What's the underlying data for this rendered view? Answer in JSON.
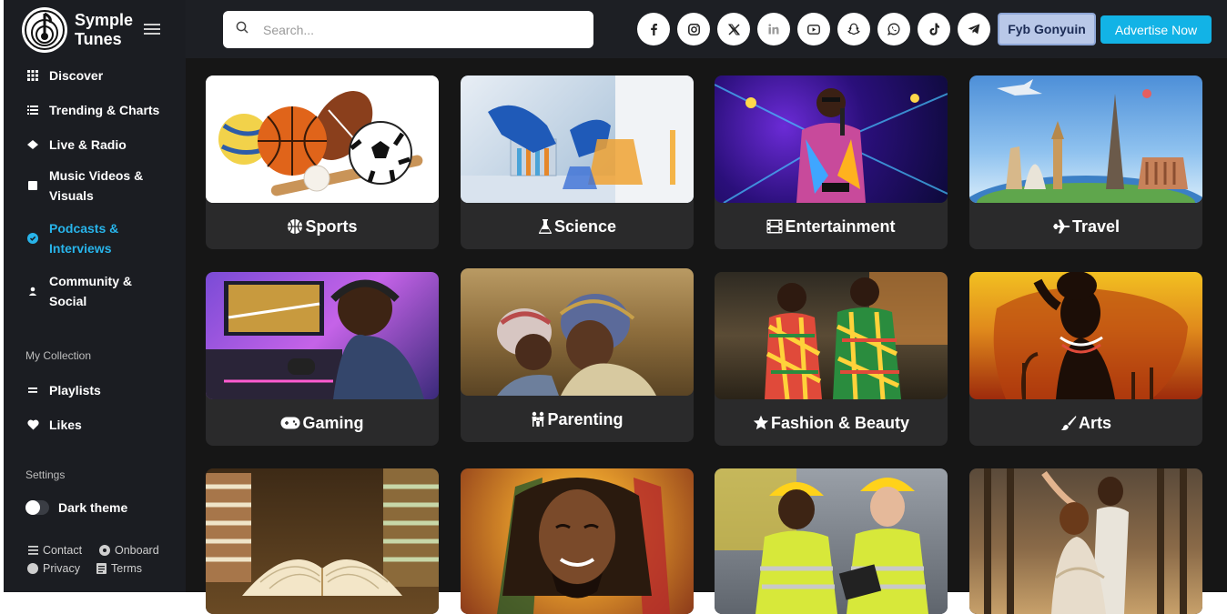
{
  "brand": {
    "name_line1": "Symple",
    "name_line2": "Tunes"
  },
  "nav": [
    {
      "label": "Discover",
      "icon": "grid-icon"
    },
    {
      "label": "Trending & Charts",
      "icon": "list-icon"
    },
    {
      "label": "Live & Radio",
      "icon": "radio-icon"
    },
    {
      "label": "Music Videos & Visuals",
      "icon": "video-icon"
    },
    {
      "label": "Podcasts & Interviews",
      "icon": "podcast-icon",
      "active": true
    },
    {
      "label": "Community & Social",
      "icon": "user-icon"
    }
  ],
  "collection": {
    "title": "My Collection",
    "items": [
      {
        "label": "Playlists",
        "icon": "playlist-icon"
      },
      {
        "label": "Likes",
        "icon": "heart-icon"
      }
    ]
  },
  "settings": {
    "title": "Settings",
    "dark_theme_label": "Dark theme",
    "dark_theme_on": false
  },
  "footer": {
    "contact": "Contact",
    "onboard": "Onboard",
    "privacy": "Privacy",
    "terms": "Terms"
  },
  "search": {
    "placeholder": "Search..."
  },
  "socials": [
    "facebook-icon",
    "instagram-icon",
    "x-icon",
    "linkedin-icon",
    "youtube-icon",
    "snapchat-icon",
    "whatsapp-icon",
    "tiktok-icon",
    "telegram-icon"
  ],
  "header": {
    "user_button": "Fyb Gonyuin",
    "advertise_button": "Advertise Now"
  },
  "categories": [
    {
      "label": "Sports",
      "icon": "basketball-icon"
    },
    {
      "label": "Science",
      "icon": "flask-icon"
    },
    {
      "label": "Entertainment",
      "icon": "film-icon"
    },
    {
      "label": "Travel",
      "icon": "plane-icon"
    },
    {
      "label": "Gaming",
      "icon": "gamepad-icon"
    },
    {
      "label": "Parenting",
      "icon": "family-icon"
    },
    {
      "label": "Fashion & Beauty",
      "icon": "star-icon"
    },
    {
      "label": "Arts",
      "icon": "brush-icon"
    },
    {
      "label": "",
      "icon": ""
    },
    {
      "label": "",
      "icon": ""
    },
    {
      "label": "",
      "icon": ""
    },
    {
      "label": "",
      "icon": ""
    }
  ],
  "colors": {
    "accent": "#28b4ea",
    "advertise": "#12b3e6",
    "sidebar_bg": "#1b1d22",
    "main_bg": "#161616",
    "card_bg": "#2a2a2b"
  }
}
